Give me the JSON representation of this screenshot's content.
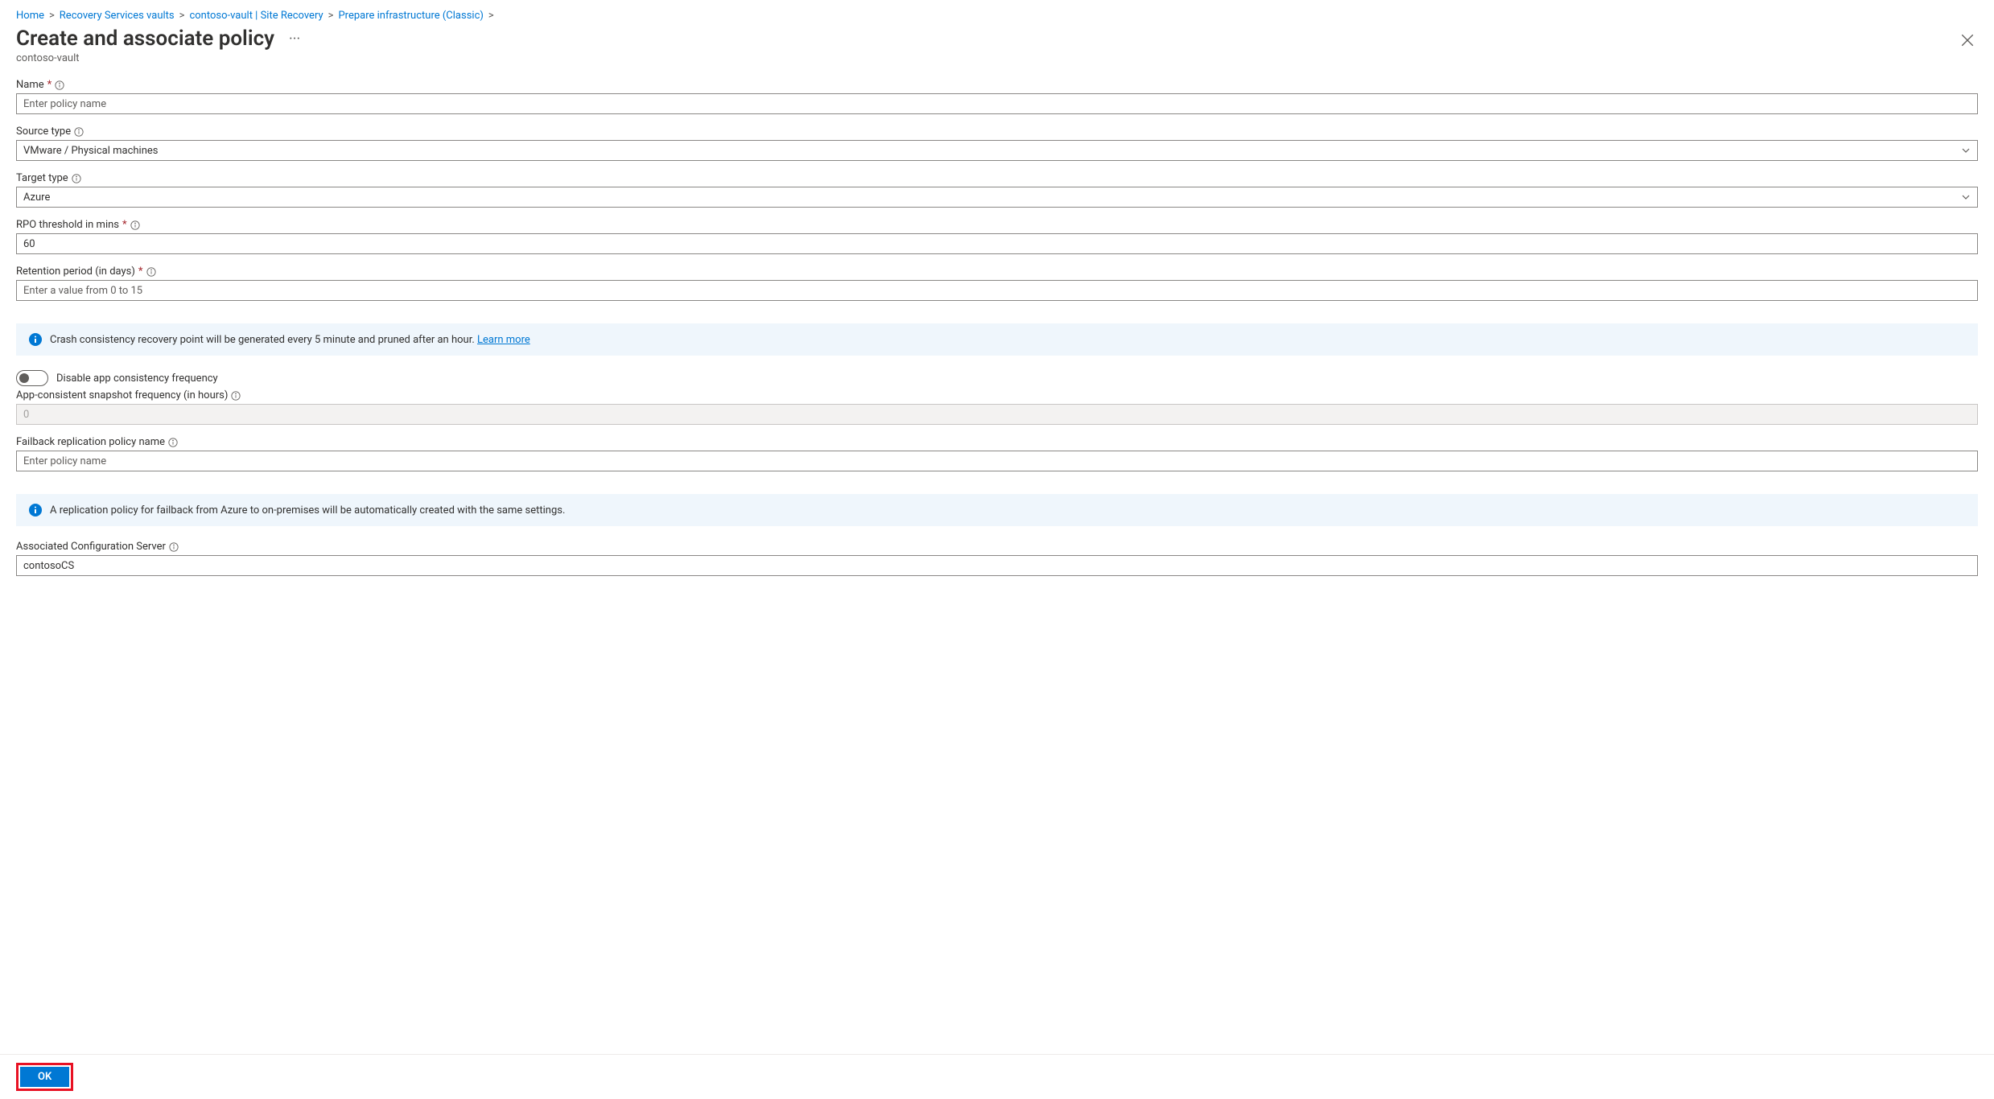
{
  "breadcrumb": [
    {
      "label": "Home"
    },
    {
      "label": "Recovery Services vaults"
    },
    {
      "label": "contoso-vault | Site Recovery"
    },
    {
      "label": "Prepare infrastructure (Classic)"
    }
  ],
  "header": {
    "title": "Create and associate policy",
    "subtitle": "contoso-vault"
  },
  "fields": {
    "name": {
      "label": "Name",
      "placeholder": "Enter policy name",
      "value": ""
    },
    "sourceType": {
      "label": "Source type",
      "value": "VMware / Physical machines"
    },
    "targetType": {
      "label": "Target type",
      "value": "Azure"
    },
    "rpoThreshold": {
      "label": "RPO threshold in mins",
      "value": "60"
    },
    "retentionPeriod": {
      "label": "Retention period (in days)",
      "placeholder": "Enter a value from 0 to 15",
      "value": ""
    },
    "appConsistencyToggle": {
      "label": "Disable app consistency frequency"
    },
    "appSnapshotFreq": {
      "label": "App-consistent snapshot frequency (in hours)",
      "value": "0"
    },
    "failbackPolicy": {
      "label": "Failback replication policy name",
      "placeholder": "Enter policy name",
      "value": ""
    },
    "associatedConfigServer": {
      "label": "Associated Configuration Server",
      "value": "contosoCS"
    }
  },
  "banners": {
    "crashConsistency": {
      "text": "Crash consistency recovery point will be generated every 5 minute and pruned after an hour. ",
      "link": "Learn more"
    },
    "failbackInfo": {
      "text": "A replication policy for failback from Azure to on-premises will be automatically created with the same settings."
    }
  },
  "footer": {
    "okLabel": "OK"
  }
}
